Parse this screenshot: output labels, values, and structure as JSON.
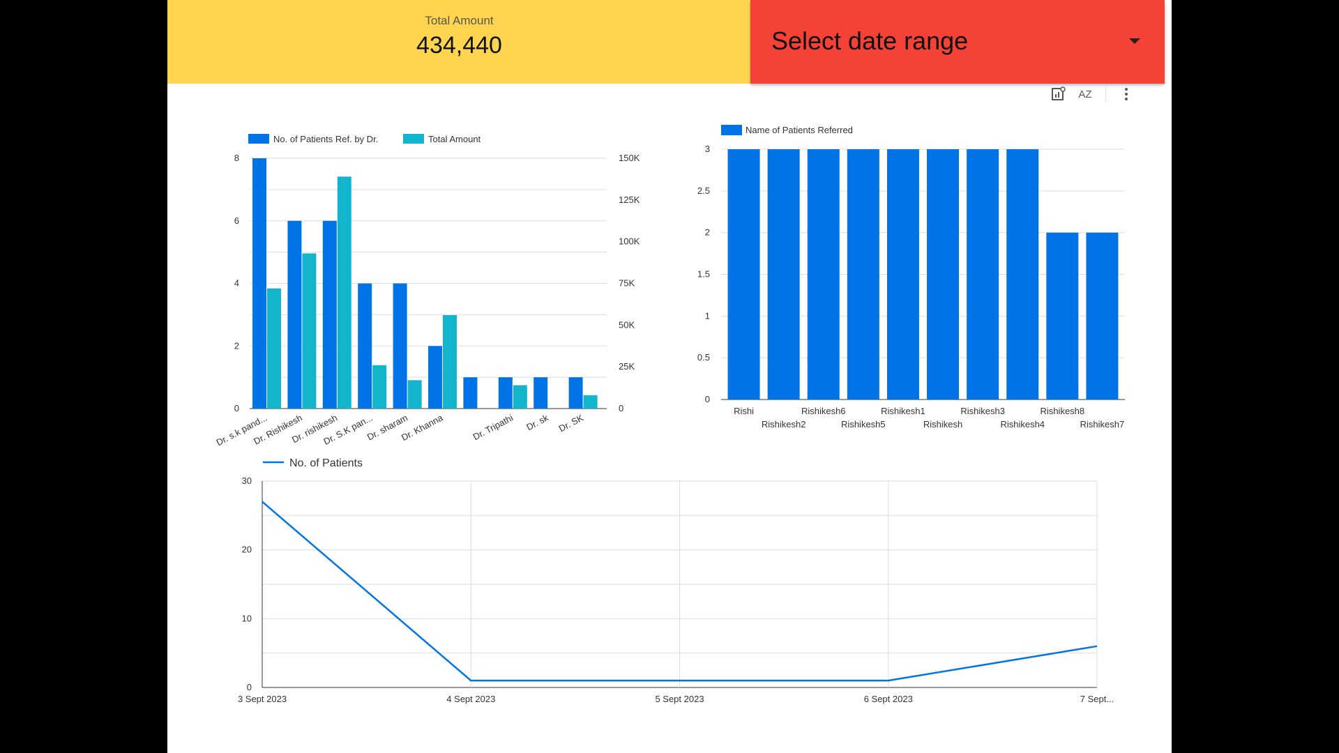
{
  "kpi": {
    "label": "Total Amount",
    "value": "434,440"
  },
  "date_control": {
    "label": "Select date range"
  },
  "toolbar": {
    "icons": [
      "chart-insights-icon",
      "sort-az-icon",
      "more-vert-icon"
    ],
    "sort_label": "AZ"
  },
  "colors": {
    "kpi_bg": "#ffd54f",
    "date_bg": "#f44336",
    "series_blue": "#0073e6",
    "series_teal": "#12b5cb"
  },
  "chart_data": [
    {
      "type": "bar",
      "categories": [
        "Dr. s.k pand...",
        "Dr. Rishikesh",
        "Dr. rishikesh",
        "Dr. S.K pan...",
        "Dr. sharam",
        "Dr. Khanna",
        "",
        "Dr. Tripathi",
        "Dr. sk",
        "Dr. SK"
      ],
      "series": [
        {
          "name": "No. of Patients Ref. by Dr.",
          "axis": "left",
          "values": [
            8,
            6,
            6,
            4,
            4,
            2,
            1,
            1,
            1,
            1
          ]
        },
        {
          "name": "Total Amount",
          "axis": "right",
          "values": [
            72000,
            93000,
            139000,
            26000,
            17000,
            56000,
            0,
            14000,
            0,
            8000
          ]
        }
      ],
      "ylim_left": [
        0,
        8
      ],
      "yticks_left": [
        "0",
        "2",
        "4",
        "6",
        "8"
      ],
      "ylim_right": [
        0,
        150000
      ],
      "yticks_right": [
        "0",
        "25K",
        "50K",
        "75K",
        "100K",
        "125K",
        "150K"
      ],
      "legend": "top",
      "grid": true
    },
    {
      "type": "bar",
      "categories": [
        "Rishi",
        "Rishikesh2",
        "Rishikesh6",
        "Rishikesh5",
        "Rishikesh1",
        "Rishikesh",
        "Rishikesh3",
        "Rishikesh4",
        "Rishikesh8",
        "Rishikesh7"
      ],
      "series": [
        {
          "name": "Name of Patients Referred",
          "values": [
            3,
            3,
            3,
            3,
            3,
            3,
            3,
            3,
            2,
            2
          ]
        }
      ],
      "ylim": [
        0,
        3
      ],
      "yticks": [
        "0",
        "0.5",
        "1",
        "1.5",
        "2",
        "2.5",
        "3"
      ],
      "legend": "top",
      "grid": true
    },
    {
      "type": "line",
      "x": [
        "3 Sept 2023",
        "4 Sept 2023",
        "5 Sept 2023",
        "6 Sept 2023",
        "7 Sept..."
      ],
      "series": [
        {
          "name": "No. of Patients",
          "values": [
            27,
            1,
            1,
            1,
            6
          ]
        }
      ],
      "ylim": [
        0,
        30
      ],
      "yticks": [
        "0",
        "10",
        "20",
        "30"
      ],
      "legend": "top-left",
      "grid": true
    }
  ]
}
